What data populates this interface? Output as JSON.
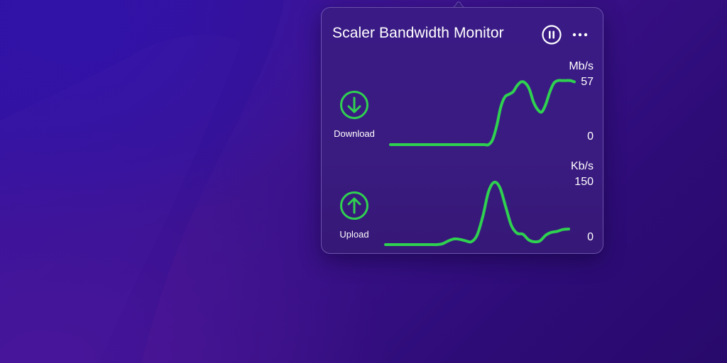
{
  "window": {
    "title": "Scaler Bandwidth Monitor"
  },
  "controls": {
    "pause_icon": "pause-circle-icon",
    "more_icon": "ellipsis-icon"
  },
  "accent": "#2fd150",
  "download": {
    "label": "Download",
    "icon": "arrow-down-circle-icon",
    "unit": "Mb/s",
    "max": "57",
    "min": "0",
    "series": [
      0,
      0,
      0,
      0,
      0,
      0,
      0,
      0,
      0,
      0,
      0,
      0,
      0,
      0,
      0,
      0,
      0,
      0,
      0,
      0,
      0,
      0,
      0,
      0,
      0,
      4,
      15,
      30,
      38,
      40,
      42,
      47,
      50,
      49,
      44,
      34,
      28,
      26,
      32,
      42,
      49,
      51,
      51,
      51,
      51,
      50
    ]
  },
  "upload": {
    "label": "Upload",
    "icon": "arrow-up-circle-icon",
    "unit": "Kb/s",
    "max": "150",
    "min": "0",
    "series": [
      0,
      0,
      0,
      0,
      0,
      0,
      0,
      0,
      0,
      0,
      2,
      8,
      12,
      11,
      8,
      6,
      20,
      60,
      112,
      132,
      120,
      80,
      40,
      24,
      22,
      10,
      6,
      8,
      20,
      26,
      28,
      32,
      33
    ]
  }
}
